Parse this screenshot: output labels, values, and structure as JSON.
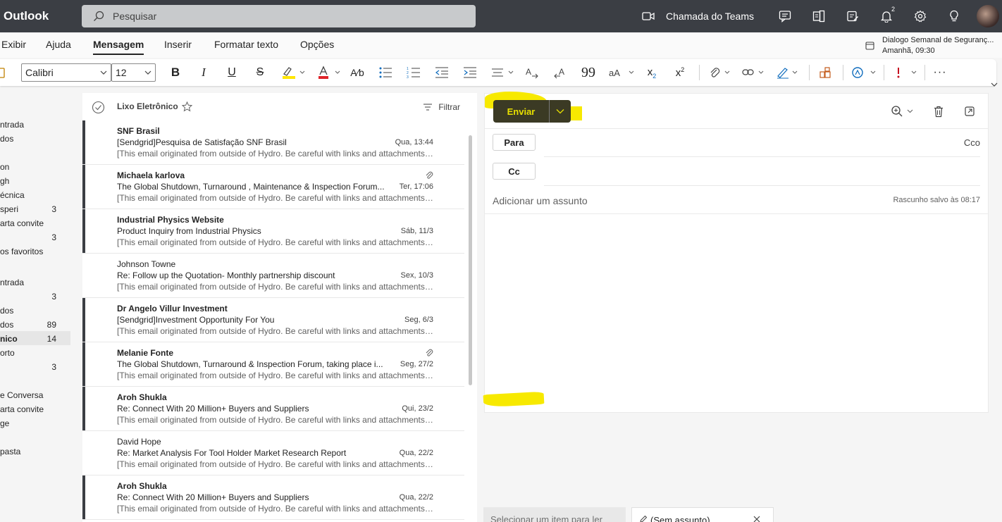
{
  "app": {
    "title": "Outlook"
  },
  "search": {
    "placeholder": "Pesquisar"
  },
  "header": {
    "teams_call": "Chamada do Teams",
    "notifications_badge": "2",
    "reminder_title": "Dialogo Semanal de Seguranç...",
    "reminder_time": "Amanhã, 09:30"
  },
  "ribbon": {
    "tabs": [
      "Exibir",
      "Ajuda",
      "Mensagem",
      "Inserir",
      "Formatar texto",
      "Opções"
    ],
    "active_tab": "Mensagem",
    "font_name": "Calibri",
    "font_size": "12"
  },
  "folders": [
    {
      "label": "ntrada",
      "count": ""
    },
    {
      "label": "dos",
      "count": ""
    },
    {
      "label": "on",
      "count": ""
    },
    {
      "label": "gh",
      "count": ""
    },
    {
      "label": "écnica",
      "count": ""
    },
    {
      "label": "speri",
      "count": "3"
    },
    {
      "label": "arta convite",
      "count": ""
    },
    {
      "label": "",
      "count": "3"
    },
    {
      "label": "os favoritos",
      "count": ""
    },
    {
      "label": "ntrada",
      "count": ""
    },
    {
      "label": "",
      "count": "3"
    },
    {
      "label": "dos",
      "count": ""
    },
    {
      "label": "dos",
      "count": "89"
    },
    {
      "label": "nico",
      "count": "14"
    },
    {
      "label": "orto",
      "count": ""
    },
    {
      "label": "",
      "count": "3"
    },
    {
      "label": "e Conversa",
      "count": ""
    },
    {
      "label": "arta convite",
      "count": ""
    },
    {
      "label": "ge",
      "count": ""
    },
    {
      "label": "pasta",
      "count": ""
    }
  ],
  "message_list": {
    "folder_title": "Lixo Eletrônico",
    "filter_label": "Filtrar",
    "messages": [
      {
        "from": "SNF Brasil",
        "subject": "[Sendgrid]Pesquisa de Satisfação SNF Brasil",
        "date": "Qua, 13:44",
        "preview": "[This email originated from outside of Hydro. Be careful with links and attachments....",
        "unread": true,
        "attachment": false
      },
      {
        "from": "Michaela karlova",
        "subject": "The Global Shutdown, Turnaround , Maintenance & Inspection Forum...",
        "date": "Ter, 17:06",
        "preview": "[This email originated from outside of Hydro. Be careful with links and attachments....",
        "unread": true,
        "attachment": true
      },
      {
        "from": "Industrial Physics Website",
        "subject": "Product Inquiry from Industrial Physics",
        "date": "Sáb, 11/3",
        "preview": "[This email originated from outside of Hydro. Be careful with links and attachments....",
        "unread": true,
        "attachment": false
      },
      {
        "from": "Johnson Towne",
        "subject": "Re:  Follow up the Quotation- Monthly partnership discount",
        "date": "Sex, 10/3",
        "preview": "[This email originated from outside of Hydro. Be careful with links and attachments....",
        "unread": false,
        "attachment": false
      },
      {
        "from": "Dr Angelo Villur Investment",
        "subject": "[Sendgrid]Investment Opportunity For You",
        "date": "Seg, 6/3",
        "preview": "[This email originated from outside of Hydro. Be careful with links and attachments....",
        "unread": true,
        "attachment": false
      },
      {
        "from": "Melanie Fonte",
        "subject": "The Global Shutdown, Turnaround & Inspection Forum, taking place i...",
        "date": "Seg, 27/2",
        "preview": "[This email originated from outside of Hydro. Be careful with links and attachments....",
        "unread": true,
        "attachment": true
      },
      {
        "from": "Aroh Shukla",
        "subject": "Re: Connect With 20 Million+ Buyers and Suppliers",
        "date": "Qui, 23/2",
        "preview": "[This email originated from outside of Hydro. Be careful with links and attachments....",
        "unread": true,
        "attachment": false
      },
      {
        "from": "David Hope",
        "subject": "Re: Market Analysis For Tool Holder Market Research Report",
        "date": "Qua, 22/2",
        "preview": "[This email originated from outside of Hydro. Be careful with links and attachments....",
        "unread": false,
        "attachment": false
      },
      {
        "from": "Aroh Shukla",
        "subject": "Re: Connect With 20 Million+ Buyers and Suppliers",
        "date": "Qua, 22/2",
        "preview": "[This email originated from outside of Hydro. Be careful with links and attachments....",
        "unread": true,
        "attachment": false
      }
    ]
  },
  "compose": {
    "send_label": "Enviar",
    "to_label": "Para",
    "cc_label": "Cc",
    "bcc_label": "Cco",
    "subject_placeholder": "Adicionar um assunto",
    "draft_status": "Rascunho salvo às 08:17"
  },
  "bottom_tabs": {
    "reading": "Selecionar um item para ler",
    "draft": "(Sem assunto)"
  },
  "colors": {
    "topbar": "#3b3e44",
    "send_button": "#3b3a24",
    "highlight": "#f7e900"
  }
}
